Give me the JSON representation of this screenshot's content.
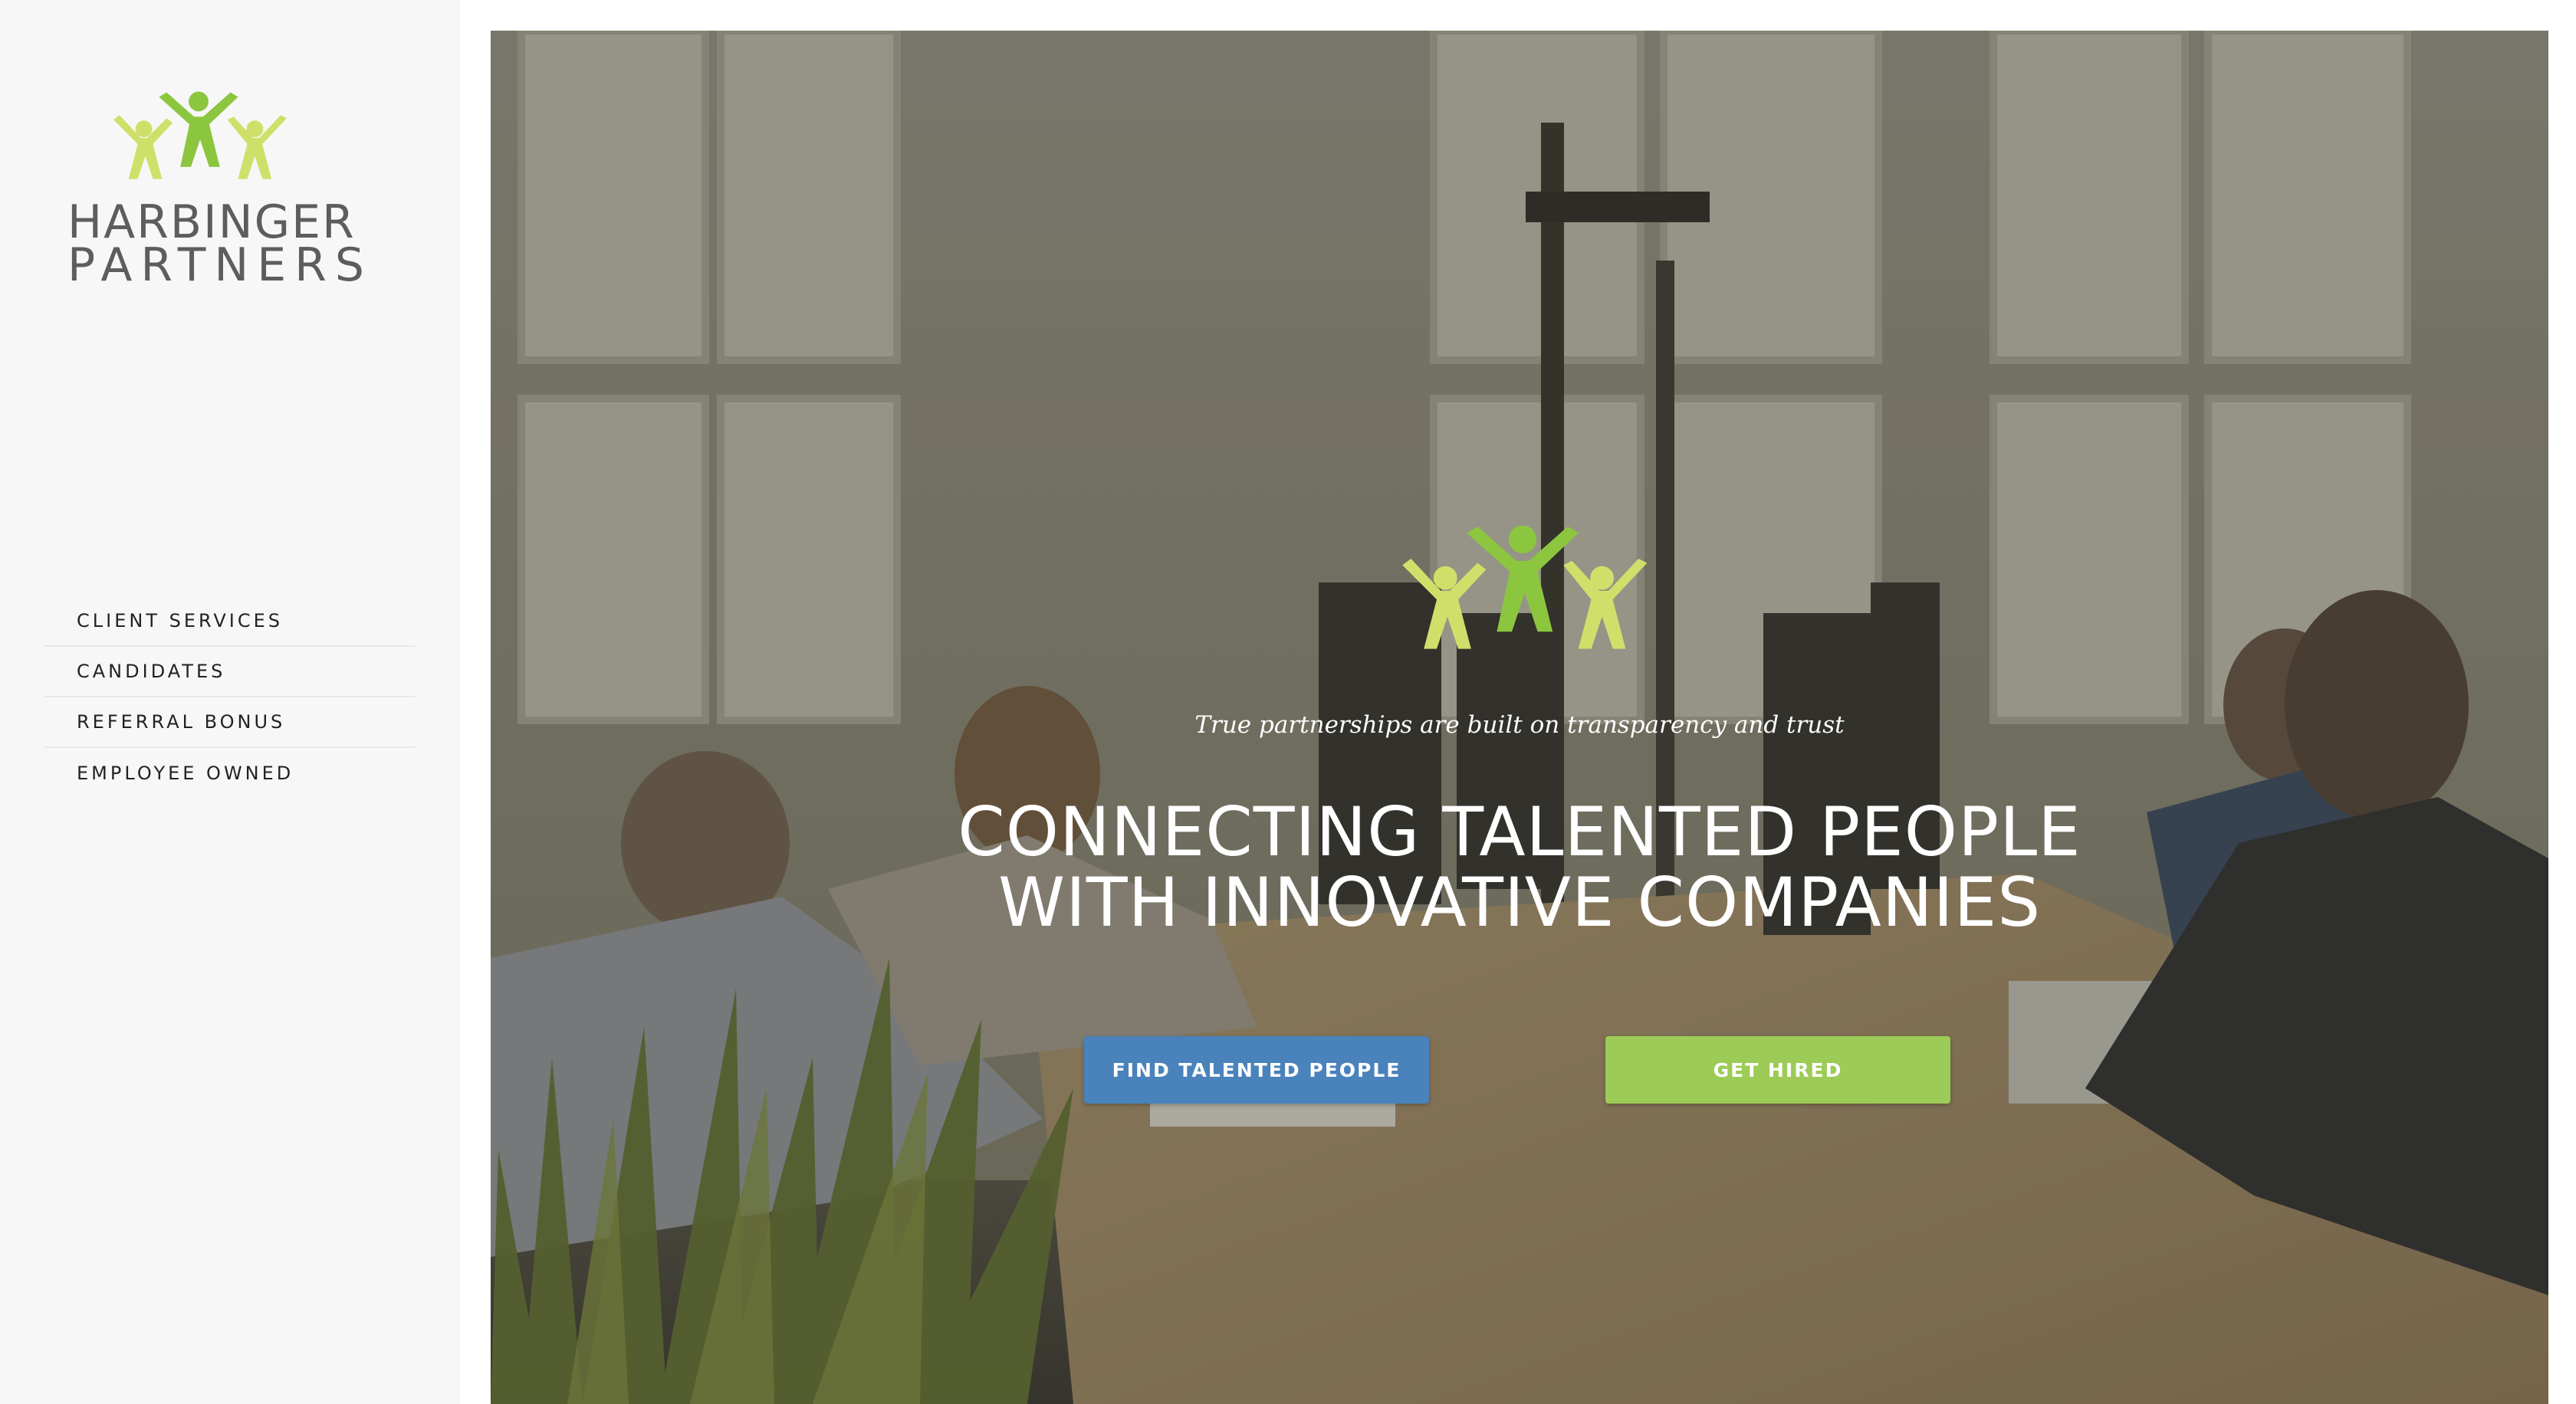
{
  "brand": {
    "name_line1": "HARBINGER",
    "name_line2": "PARTNERS",
    "logo_icon": "three-people-icon",
    "colors": {
      "light_green": "#cfe06a",
      "green": "#8cc63f",
      "text_gray": "#5d5d5d"
    }
  },
  "nav": {
    "items": [
      {
        "label": "CLIENT SERVICES"
      },
      {
        "label": "CANDIDATES"
      },
      {
        "label": "REFERRAL BONUS"
      },
      {
        "label": "EMPLOYEE OWNED"
      }
    ]
  },
  "hero": {
    "tagline": "True partnerships are built on transparency and trust",
    "headline_line1": "CONNECTING TALENTED PEOPLE",
    "headline_line2": "WITH INNOVATIVE COMPANIES",
    "buttons": {
      "find_label": "FIND TALENTED PEOPLE",
      "hired_label": "GET HIRED"
    },
    "colors": {
      "button_blue": "#4a82bb",
      "button_green": "#9ccb57"
    }
  }
}
